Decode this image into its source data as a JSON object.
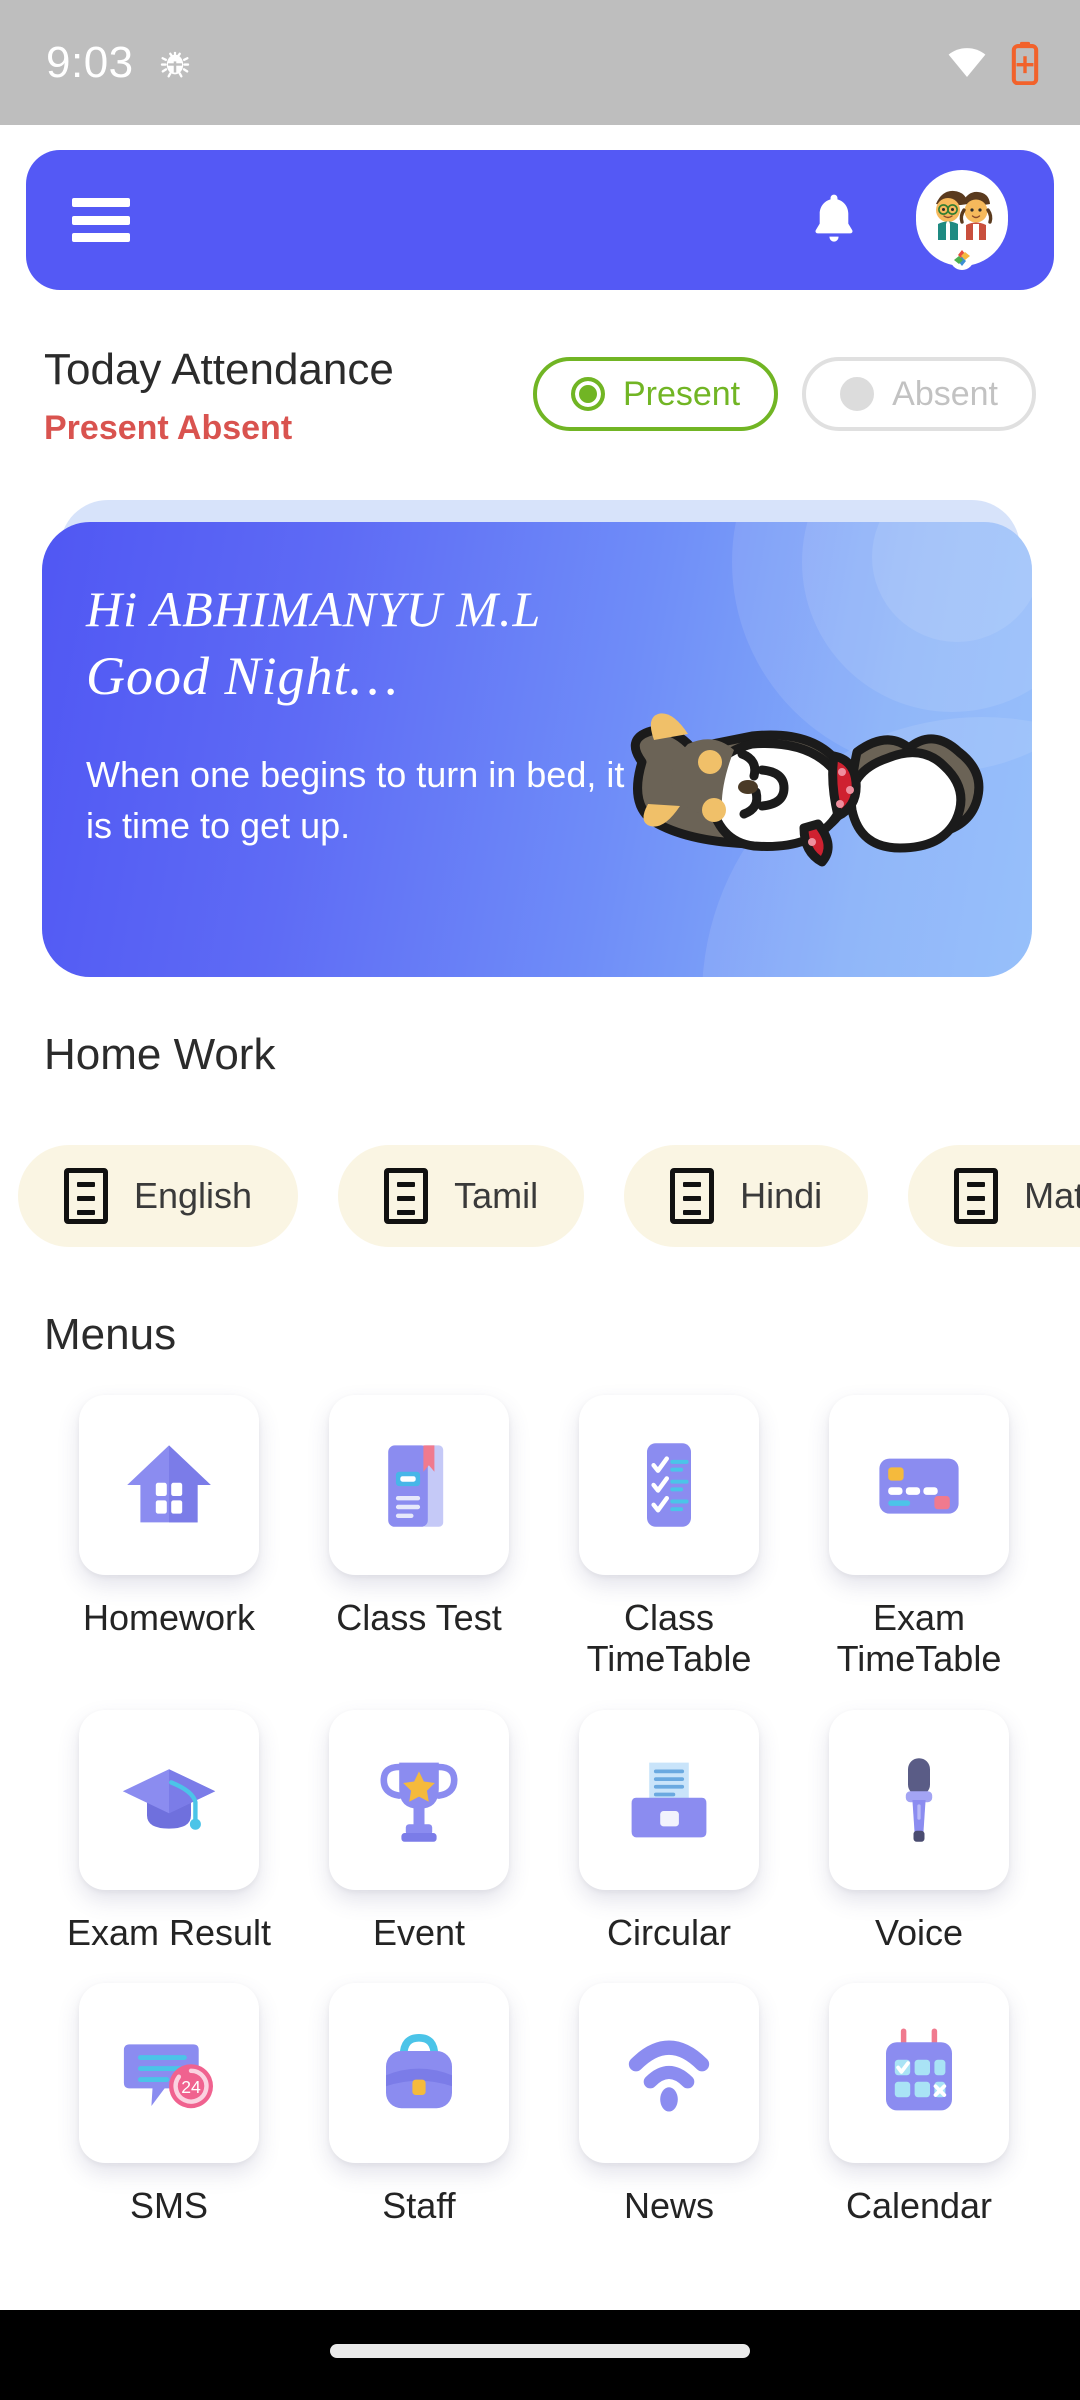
{
  "status_bar": {
    "time": "9:03",
    "icons": [
      "bug-icon",
      "wifi-icon",
      "battery-saver-icon"
    ]
  },
  "app_bar": {
    "menu_icon": "hamburger-menu-icon",
    "notification_icon": "bell-icon",
    "avatar": "student-avatar",
    "color": "#5459f5"
  },
  "attendance": {
    "title": "Today Attendance",
    "subtitle": "Present Absent",
    "subtitle_color": "#d9534f",
    "options": [
      {
        "label": "Present",
        "selected": true,
        "color": "#71b524"
      },
      {
        "label": "Absent",
        "selected": false,
        "color": "#c2c2c2"
      }
    ]
  },
  "greeting": {
    "hi_line": "Hi ABHIMANYU M.L",
    "greeting_line": "Good Night…",
    "quote": "When one begins to turn in bed, it is time to get up.",
    "illustration": "sleeping-cat-illustration",
    "gradient_from": "#5057f3",
    "gradient_to": "#8cb9fa"
  },
  "homework": {
    "title": "Home Work",
    "chips": [
      {
        "label": "English",
        "icon": "document-icon"
      },
      {
        "label": "Tamil",
        "icon": "document-icon"
      },
      {
        "label": "Hindi",
        "icon": "document-icon"
      },
      {
        "label": "Maths",
        "icon": "document-icon"
      }
    ]
  },
  "menus": {
    "title": "Menus",
    "items": [
      {
        "label": "Homework",
        "icon": "house-icon"
      },
      {
        "label": "Class Test",
        "icon": "book-icon"
      },
      {
        "label": "Class TimeTable",
        "icon": "checklist-icon"
      },
      {
        "label": "Exam TimeTable",
        "icon": "card-icon"
      },
      {
        "label": "Exam Result",
        "icon": "graduation-cap-icon"
      },
      {
        "label": "Event",
        "icon": "trophy-icon"
      },
      {
        "label": "Circular",
        "icon": "printer-icon"
      },
      {
        "label": "Voice",
        "icon": "microphone-icon"
      },
      {
        "label": "SMS",
        "icon": "chat-bubble-icon",
        "badge": "24"
      },
      {
        "label": "Staff",
        "icon": "backpack-icon"
      },
      {
        "label": "News",
        "icon": "signal-icon"
      },
      {
        "label": "Calendar",
        "icon": "calendar-icon"
      }
    ]
  },
  "nav_bar": {
    "gesture_pill": "home-gesture-pill"
  }
}
